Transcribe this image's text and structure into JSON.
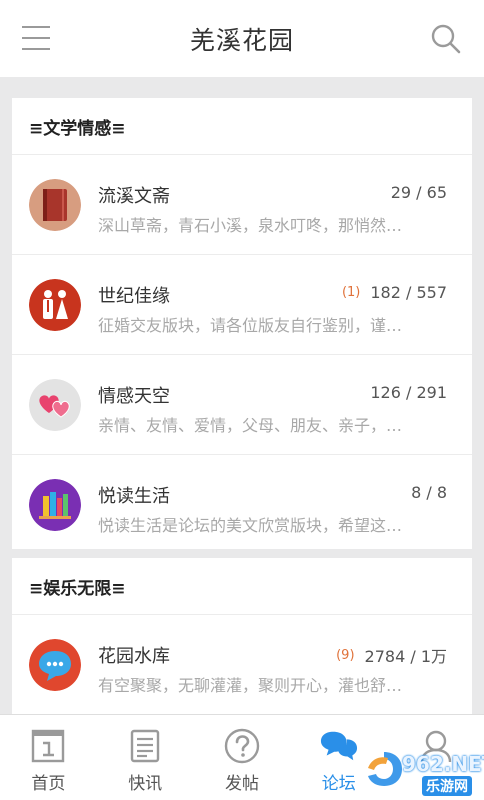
{
  "header": {
    "title": "羌溪花园"
  },
  "sections": [
    {
      "title": "≡文学情感≡",
      "items": [
        {
          "name": "流溪文斋",
          "desc": "深山草斋，青石小溪，泉水叮咚，那悄然…",
          "stats": "29 / 65",
          "new": ""
        },
        {
          "name": "世纪佳缘",
          "desc": "征婚交友版块，请各位版友自行鉴别，谨…",
          "stats": "182 / 557",
          "new": "(1)"
        },
        {
          "name": "情感天空",
          "desc": "亲情、友情、爱情，父母、朋友、亲子，…",
          "stats": "126 / 291",
          "new": ""
        },
        {
          "name": "悦读生活",
          "desc": "悦读生活是论坛的美文欣赏版块，希望这…",
          "stats": "8 / 8",
          "new": ""
        }
      ]
    },
    {
      "title": "≡娱乐无限≡",
      "items": [
        {
          "name": "花园水库",
          "desc": "有空聚聚，无聊灌灌，聚则开心，灌也舒…",
          "stats": "2784 / 1万",
          "new": "(9)"
        }
      ]
    }
  ],
  "tabs": [
    {
      "label": "首页",
      "icon": "home-icon"
    },
    {
      "label": "快讯",
      "icon": "news-icon"
    },
    {
      "label": "发帖",
      "icon": "question-icon"
    },
    {
      "label": "论坛",
      "icon": "chat-bubbles-icon"
    },
    {
      "label": "",
      "icon": "user-icon"
    }
  ],
  "watermark": {
    "text": "962.NET",
    "sub": "乐游网"
  },
  "colors": {
    "accent": "#2a8fe8",
    "new_badge": "#e0723a",
    "background": "#e9e9ea"
  }
}
